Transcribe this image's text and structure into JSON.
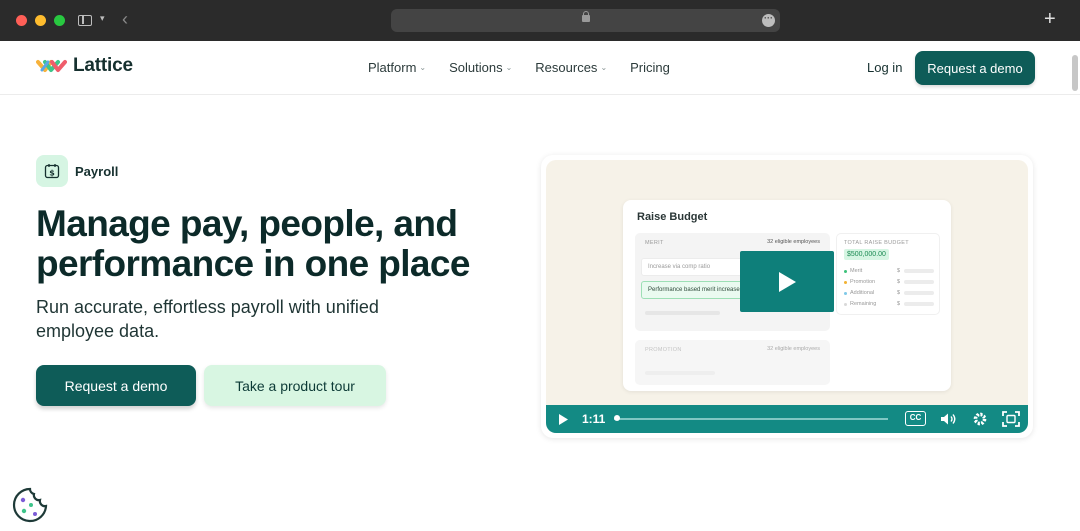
{
  "browser": {
    "url_display": ""
  },
  "nav": {
    "logo_text": "Lattice",
    "links": [
      {
        "label": "Platform",
        "has_dropdown": true
      },
      {
        "label": "Solutions",
        "has_dropdown": true
      },
      {
        "label": "Resources",
        "has_dropdown": true
      },
      {
        "label": "Pricing",
        "has_dropdown": false
      }
    ],
    "login_label": "Log in",
    "cta_label": "Request a demo"
  },
  "hero": {
    "badge_label": "Payroll",
    "badge_icon": "dollar-calendar-icon",
    "title": "Manage pay, people, and performance in one place",
    "subtitle": "Run accurate, effortless payroll with unified employee data.",
    "primary_cta": "Request a demo",
    "secondary_cta": "Take a product tour"
  },
  "video": {
    "mockup": {
      "title": "Raise Budget",
      "merit_label": "MERIT",
      "merit_count": "32 eligible employees",
      "field_1": "Increase via comp ratio",
      "field_2": "Performance based merit increase",
      "promotion_label": "PROMOTION",
      "promotion_count": "32 eligible employees",
      "total_label": "TOTAL RAISE BUDGET",
      "total_value": "$500,000.00",
      "legend": [
        {
          "label": "Merit",
          "value": "$",
          "color": "#3cc27a"
        },
        {
          "label": "Promotion",
          "value": "$",
          "color": "#f2b233"
        },
        {
          "label": "Additional",
          "value": "$",
          "color": "#7fc9e8"
        },
        {
          "label": "Remaining",
          "value": "$",
          "color": "#d9d9d9"
        }
      ]
    },
    "controls": {
      "time": "1:11",
      "progress": 0.01,
      "cc_label": "CC"
    }
  },
  "colors": {
    "brand_dark": "#0e5c58",
    "brand_light": "#d8f6e2",
    "video_bar": "#138a84"
  }
}
